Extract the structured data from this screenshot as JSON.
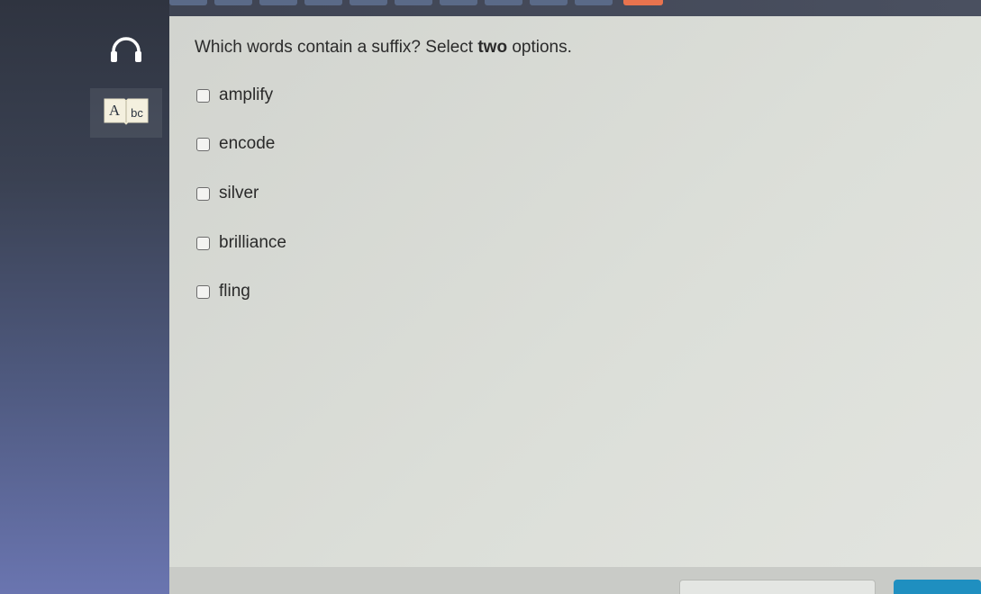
{
  "question": {
    "prefix": "Which words contain a suffix? Select ",
    "emphasis": "two",
    "suffix": " options."
  },
  "options": [
    {
      "label": "amplify",
      "checked": false
    },
    {
      "label": "encode",
      "checked": false
    },
    {
      "label": "silver",
      "checked": false
    },
    {
      "label": "brilliance",
      "checked": false
    },
    {
      "label": "fling",
      "checked": false
    }
  ],
  "tools": {
    "reader_icon": "headphones-icon",
    "dictionary_icon": "dictionary-icon",
    "dictionary_glyphs": {
      "big": "A",
      "small": "bc"
    }
  },
  "colors": {
    "current_progress": "#e8734e",
    "next_button": "#1f8fc0"
  }
}
